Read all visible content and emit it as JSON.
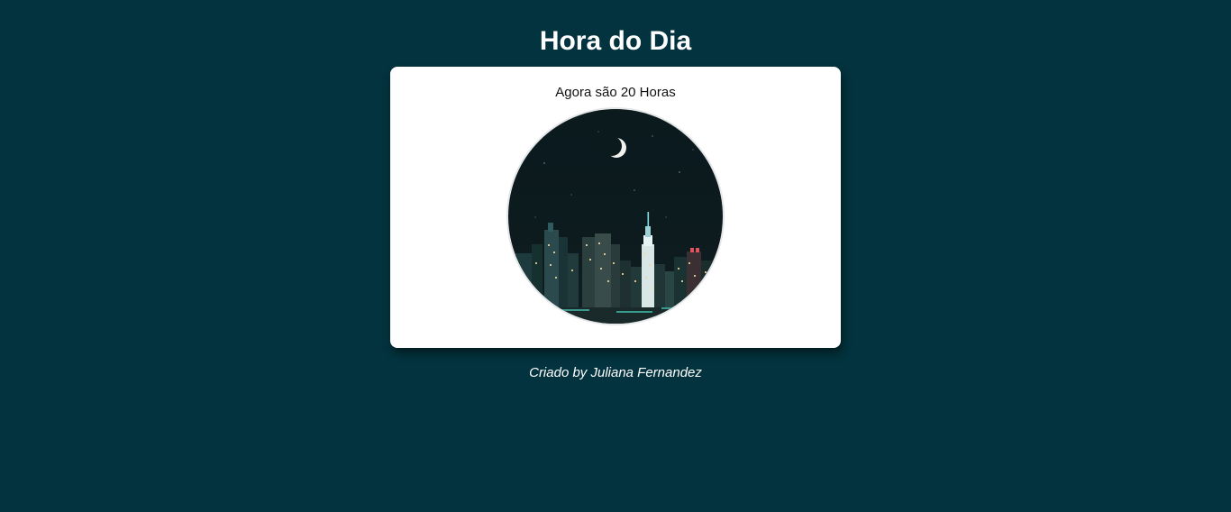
{
  "header": {
    "title": "Hora do Dia"
  },
  "card": {
    "message": "Agora são 20 Horas",
    "image": {
      "alt": "night-city-skyline",
      "period": "night"
    }
  },
  "footer": {
    "credit": "Criado by Juliana Fernandez"
  },
  "colors": {
    "background": "#03333e",
    "card": "#ffffff",
    "title": "#ffffff",
    "message": "#111111",
    "footer": "#ffffff"
  }
}
